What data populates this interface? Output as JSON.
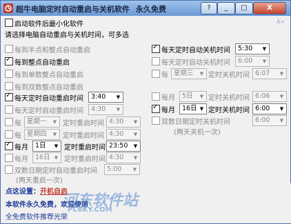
{
  "title_bar": {
    "title": "超牛电脑定时自动重启与关机软件",
    "subtitle": "永久免费",
    "btn_help": "?",
    "btn_min": "_",
    "btn_max": "□",
    "btn_close": "X"
  },
  "top": {
    "minimize_checkbox_label": "启动软件后最小化软件",
    "instruction": "请选择电脑自动重启与关机时间，可多选",
    "ab_hint": "A+"
  },
  "left": {
    "half_hour": "每到半点和整点自动重启",
    "hourly": "每到整点自动重启",
    "odd_hour": "每到单数整点自动重启",
    "even_hour": "每到双数整点自动重启",
    "daily_label": "每天定时自动重启时间",
    "daily_time": "3:40",
    "daily2_label": "每天定时自动重启时间",
    "daily2_time": "4:30",
    "week1_prefix": "每",
    "week1_day": "星期一",
    "week1_label": "定时重启时间",
    "week1_time": "4:30",
    "week2_prefix": "每",
    "week2_day": "星期四",
    "week2_label": "定时重启时间",
    "week2_time": "4:30",
    "month1_prefix": "每月",
    "month1_day": "1日",
    "month1_label": "定时重启时间",
    "month1_time": "23:50",
    "month2_prefix": "每月",
    "month2_day": "16日",
    "month2_label": "定时重启时间",
    "month2_time": "4:30",
    "double_label": "双数日期定时自动重启时间",
    "double_time": "5:00",
    "double_note": "(两天重启一次)"
  },
  "right": {
    "daily1_label": "每天定时自动关机时间",
    "daily1_time": "5:30",
    "daily2_label": "每天定时自动关机时间",
    "daily2_time": "6:00",
    "week_prefix": "每",
    "week_day": "星期三",
    "week_label": "定时关机时间",
    "week_time": "6:07",
    "month1_prefix": "每月",
    "month1_day": "5日",
    "month1_label": "定时关机时间",
    "month1_time": "6:06",
    "month2_prefix": "每月",
    "month2_day": "16日",
    "month2_label": "定时关机时间",
    "month2_time": "6:00",
    "double_label": "双数日期定时关机时间",
    "double_time": "6:00",
    "double_note": "(两天关机一次)"
  },
  "footer": {
    "autostart_prefix": "点这设置：",
    "autostart_link": "开机自启",
    "line1": "本软件永久免费，欢迎使用",
    "line2": "全免费软件推荐光荣",
    "watermark": "河东软件站",
    "watermark2": "PC6KY.COM"
  }
}
